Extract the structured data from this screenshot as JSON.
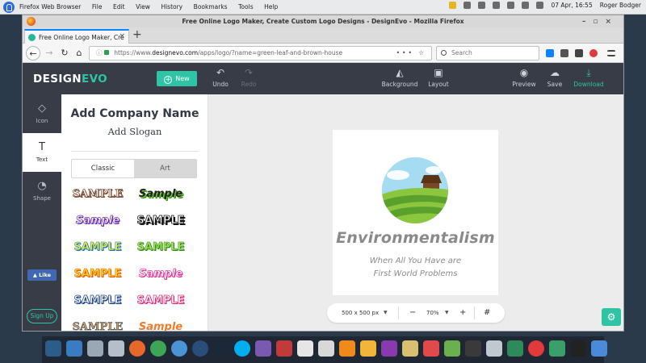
{
  "topbar": {
    "menu": [
      "Firefox Web Browser",
      "File",
      "Edit",
      "View",
      "History",
      "Bookmarks",
      "Tools",
      "Help"
    ],
    "datetime": "07 Apr, 16:55",
    "user": "Roger Bodger"
  },
  "window": {
    "title": "Free Online Logo Maker, Create Custom Logo Designs - DesignEvo - Mozilla Firefox",
    "tab_label": "Free Online Logo Maker, Cre",
    "url_prefix": "https://www.",
    "url_domain": "designevo.com",
    "url_path": "/apps/logo/?name=green-leaf-and-brown-house",
    "search_placeholder": "Search"
  },
  "app": {
    "logo_main": "DESIGN",
    "logo_accent": "EVO",
    "new_label": "New",
    "toolbar": {
      "undo": "Undo",
      "redo": "Redo",
      "background": "Background",
      "layout": "Layout",
      "preview": "Preview",
      "save": "Save",
      "download": "Download"
    },
    "sidebar": {
      "icon": "Icon",
      "text": "Text",
      "shape": "Shape",
      "like": "Like",
      "signup": "Sign Up"
    },
    "panel": {
      "company_name": "Add Company Name",
      "slogan": "Add Slogan",
      "tab_classic": "Classic",
      "tab_art": "Art",
      "samples": [
        "SAMPLE",
        "Sample",
        "Sample",
        "SAMPLE",
        "SAMPLE",
        "SAMPLE",
        "SAMPLE",
        "Sample",
        "SAMPLE",
        "SAMPLE",
        "SAMPLE",
        "Sample"
      ]
    },
    "canvas": {
      "brand": "Environmentalism",
      "slogan_line1": "When All You Have are",
      "slogan_line2": "First World Problems",
      "size_label": "500 x 500 px",
      "zoom_label": "70%",
      "zoom_minus": "−",
      "zoom_plus": "+"
    }
  },
  "colors": {
    "accent": "#2ec4a5",
    "header_bg": "#373c47"
  }
}
